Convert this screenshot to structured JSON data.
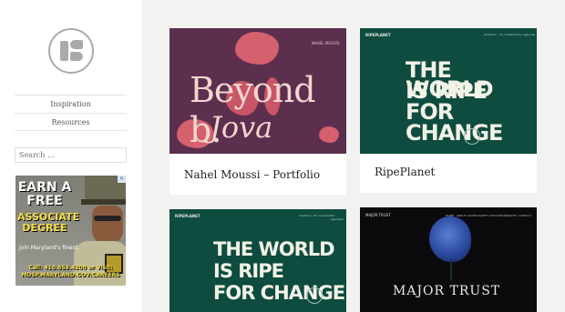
{
  "sidebar": {
    "nav": [
      {
        "label": "Inspiration"
      },
      {
        "label": "Resources"
      }
    ],
    "search": {
      "placeholder": "Search …"
    },
    "ad": {
      "line1": "EARN A FREE",
      "line2": "ASSOCIATE DEGREE",
      "line3": "Join Maryland's finest.",
      "line4": "Call: 410.653.4200 or Visit: MDSP.MARYLAND.GOV/CAREERS"
    }
  },
  "cards": [
    {
      "title": "Nahel Moussi – Portfolio",
      "thumb": {
        "header": "NAHEL MOUSSI",
        "main": "Beyond b.",
        "sub": "Jova"
      }
    },
    {
      "title": "RipePlanet",
      "thumb": {
        "logo": "RIPEPLANET",
        "nav": [
          "Solutions",
          "For investors",
          "For Agencies"
        ],
        "line1": "THE WORLD",
        "line2": "IS RIPE",
        "line3": "FOR",
        "line4": "CHANGE"
      }
    },
    {
      "title": "",
      "thumb": {
        "logo": "RIPEPLANET",
        "nav": [
          "Solutions",
          "For investors",
          "For Agencies"
        ],
        "line1": "THE WORLD",
        "line2": "IS RIPE",
        "line3": "FOR CHANGE"
      }
    },
    {
      "title": "",
      "thumb": {
        "logo": "MAJOR TRUST",
        "nav": [
          "HOME",
          "ABOUT US",
          "PHILOSOPHY",
          "ADVISORS",
          "INSIGHTS",
          "CONTACT"
        ],
        "main": "MAJOR TRUST"
      }
    }
  ]
}
